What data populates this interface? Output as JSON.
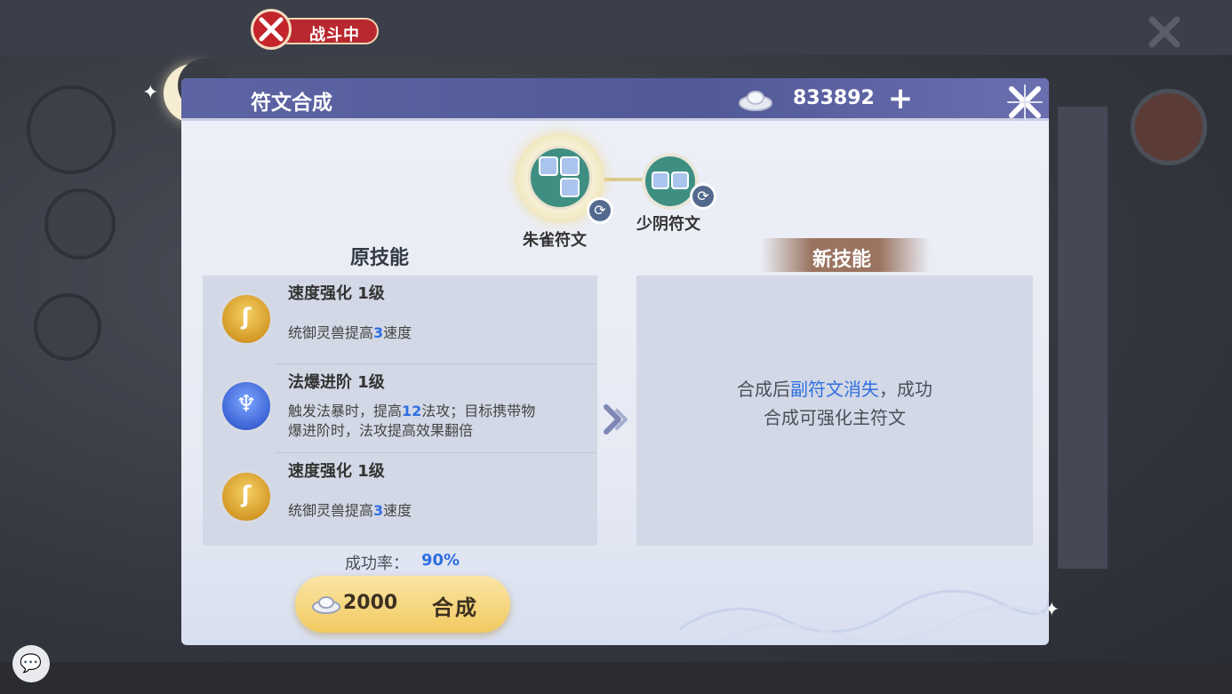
{
  "battle_status": {
    "label": "战斗中"
  },
  "dialog": {
    "title": "符文合成",
    "currency": {
      "icon": "silver-ingot-icon",
      "value": "833892",
      "add_symbol": "+"
    },
    "close_icon": "close-x-icon"
  },
  "runes": {
    "main": {
      "label": "朱雀符文",
      "icon": "rune-blocks-icon"
    },
    "sub": {
      "label": "少阴符文",
      "icon": "rune-blocks-icon"
    },
    "swap_icon": "refresh-icon"
  },
  "original_skills": {
    "title": "原技能",
    "items": [
      {
        "name": "速度强化  1级",
        "icon": "gold-shield-icon",
        "desc_pre": "统御灵兽提高",
        "desc_hl": "3",
        "desc_post": "速度",
        "desc_line2": ""
      },
      {
        "name": "法爆进阶  1级",
        "icon": "blue-spell-icon",
        "desc_pre": "触发法暴时，提高",
        "desc_hl": "12",
        "desc_post": "法攻；目标携带物",
        "desc_line2": "爆进阶时，法攻提高效果翻倍"
      },
      {
        "name": "速度强化  1级",
        "icon": "gold-shield-icon",
        "desc_pre": "统御灵兽提高",
        "desc_hl": "3",
        "desc_post": "速度",
        "desc_line2": ""
      }
    ]
  },
  "new_skills": {
    "title": "新技能",
    "hint_pre": "合成后",
    "hint_hl": "副符文消失",
    "hint_post": "，成功",
    "hint_line2": "合成可强化主符文"
  },
  "success_rate": {
    "label": "成功率：",
    "value": "90%"
  },
  "craft_button": {
    "cost": "2000",
    "label": "合成",
    "coin_icon": "silver-ingot-icon"
  },
  "colors": {
    "header": "#5d64a3",
    "accent_blue": "#2f6fe0",
    "button_gold": "#f2c960",
    "panel": "#d3d8e6"
  }
}
